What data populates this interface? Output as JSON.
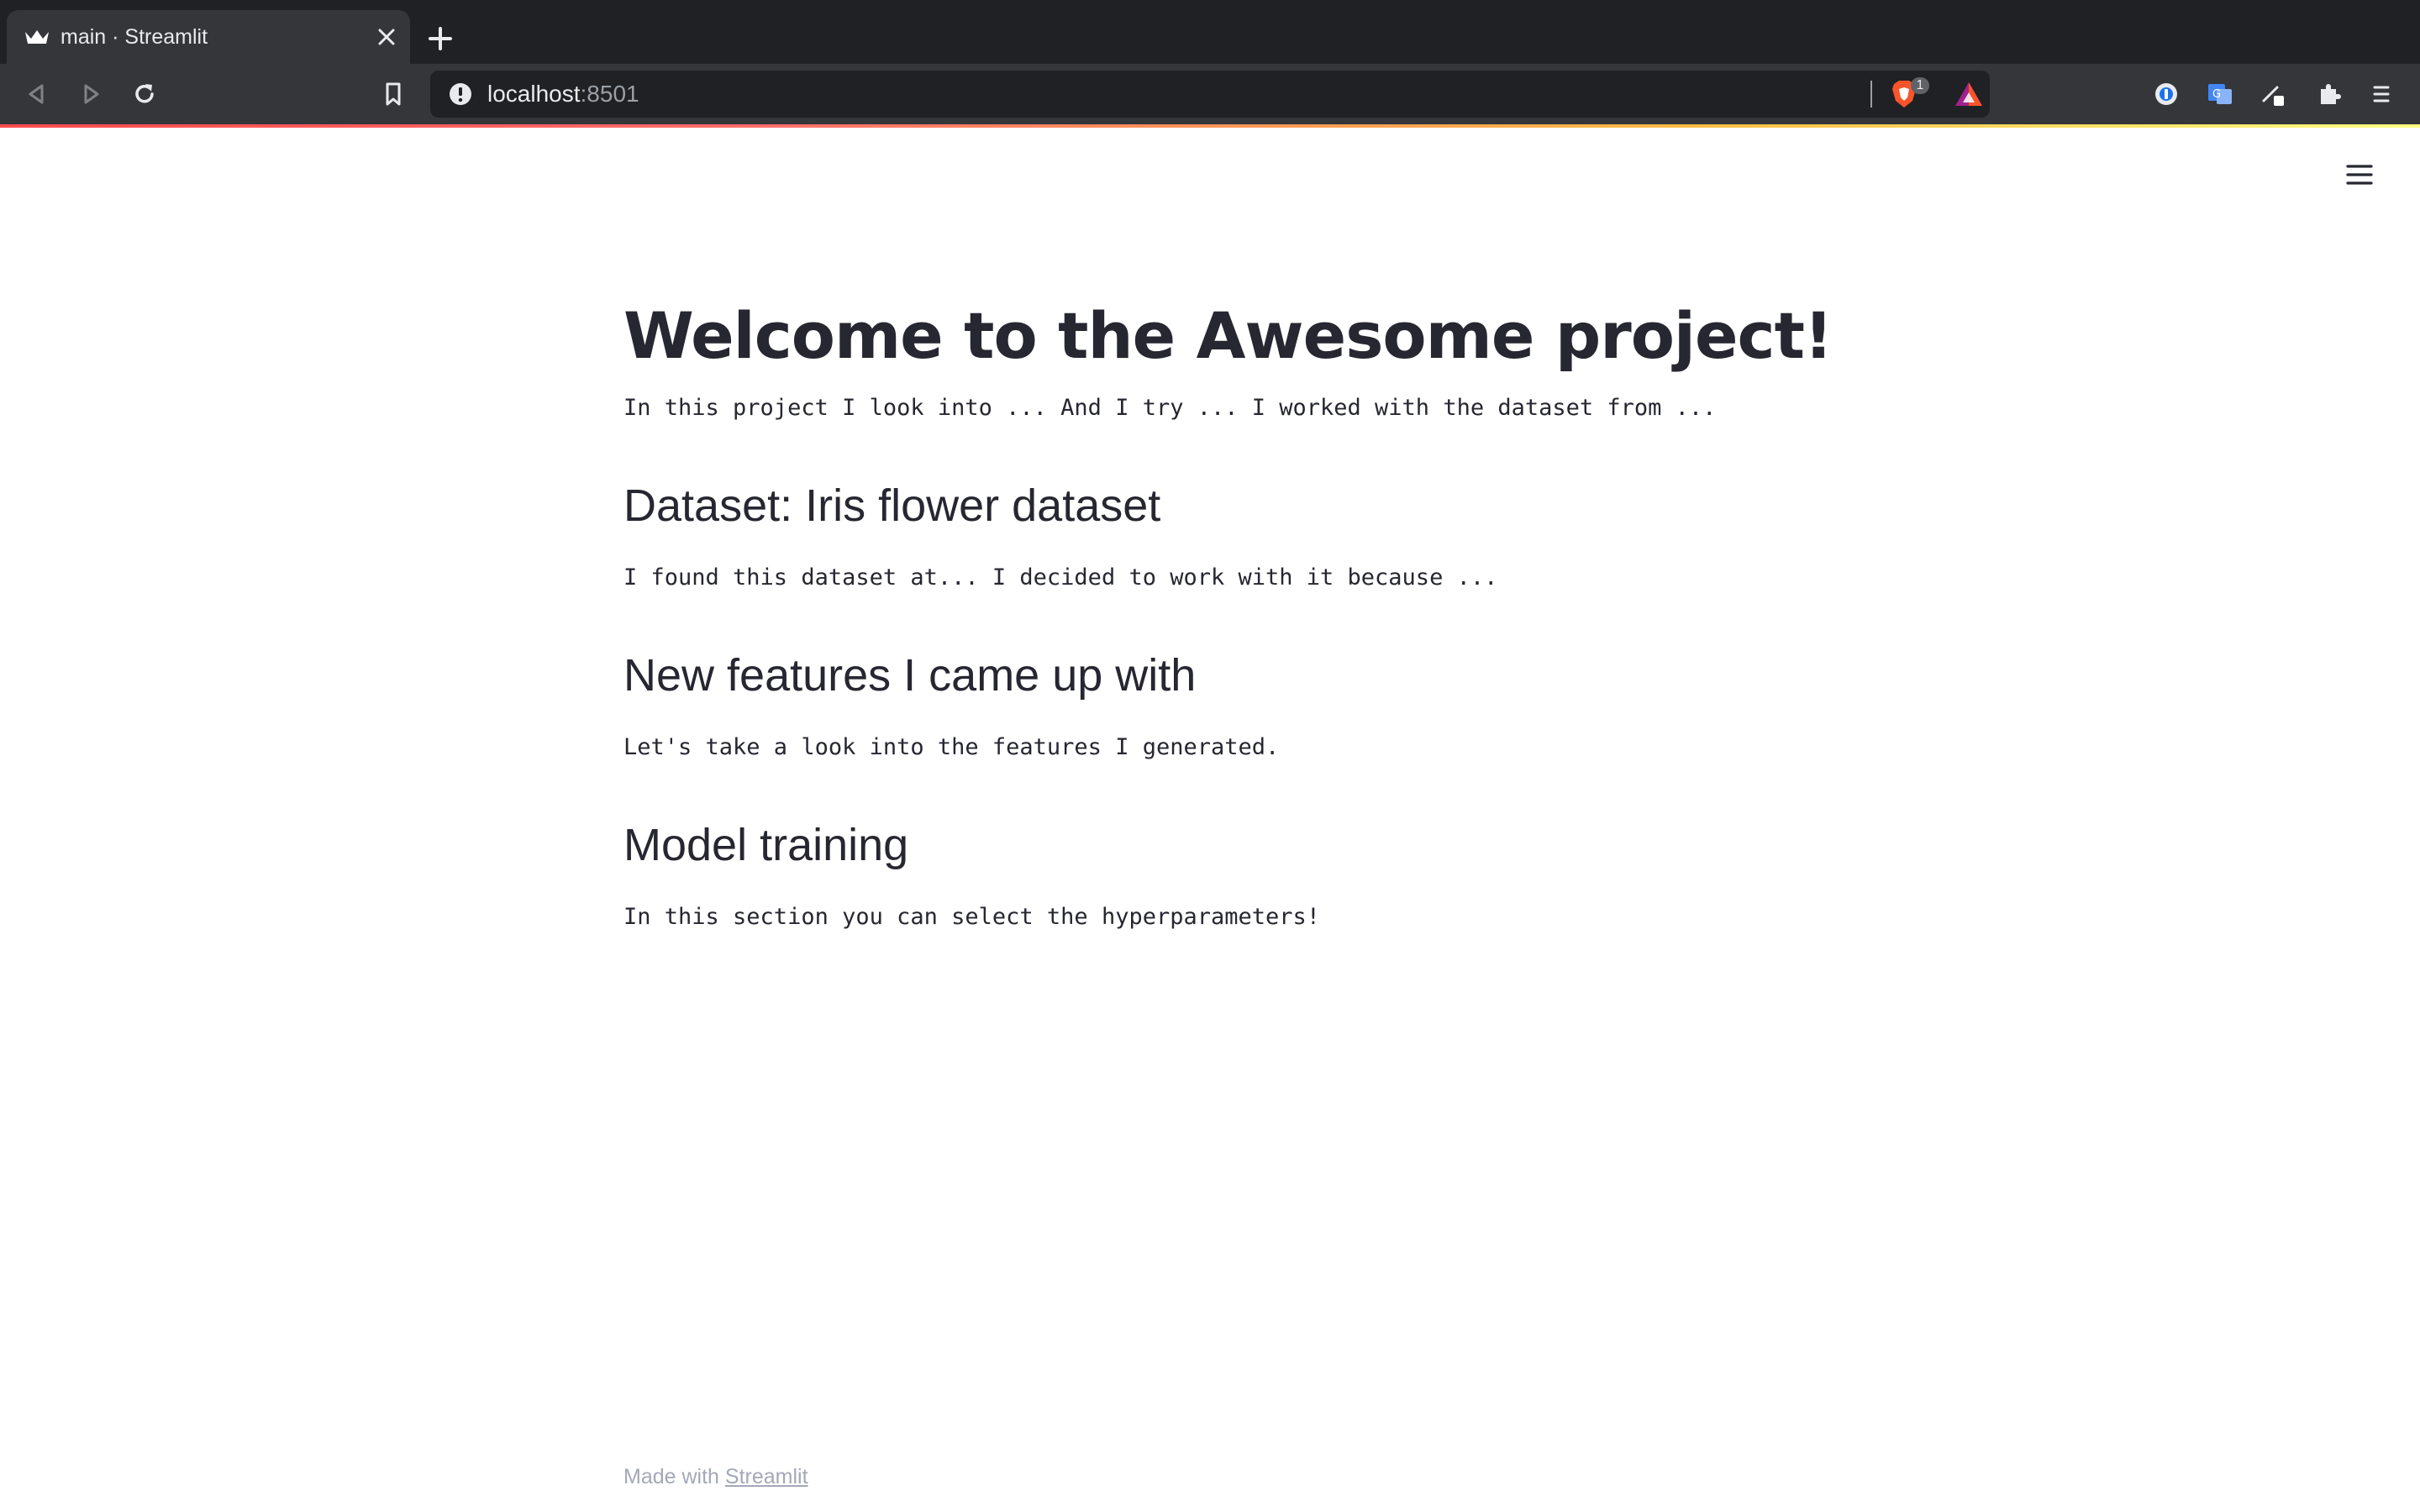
{
  "browser": {
    "tab": {
      "title": "main · Streamlit",
      "favicon": "streamlit-crown-icon"
    },
    "address_bar": {
      "host": "localhost",
      "port": ":8501"
    },
    "brave_shields_count": "1",
    "colors": {
      "tabstrip": "#202124",
      "toolbar": "#35363a",
      "accent": "#ff4b4b"
    }
  },
  "page": {
    "title": "Welcome to the Awesome project!",
    "intro": "In this project I look into ... And I try ... I worked with the dataset from ...",
    "sections": [
      {
        "header": "Dataset: Iris flower dataset",
        "text": "I found this dataset at... I decided to work with it because ..."
      },
      {
        "header": "New features I came up with",
        "text": "Let's take a look into the features I generated."
      },
      {
        "header": "Model training",
        "text": "In this section you can select the hyperparameters!"
      }
    ],
    "footer": {
      "prefix": "Made with ",
      "link": "Streamlit"
    },
    "text_color": "#262730"
  }
}
